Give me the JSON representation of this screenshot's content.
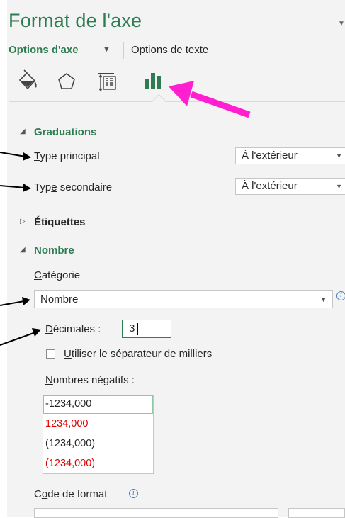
{
  "pane": {
    "title": "Format de l'axe",
    "tabs": {
      "axis_options": "Options d'axe",
      "text_options": "Options de texte"
    },
    "icons": [
      "fill-line-icon",
      "effects-icon",
      "size-properties-icon",
      "axis-options-icon"
    ]
  },
  "graduations": {
    "header": "Graduations",
    "major_type": {
      "label_first": "T",
      "label_rest": "ype principal",
      "value": "À l'extérieur"
    },
    "minor_type": {
      "label_a": "Typ",
      "label_b": "e",
      "label_c": " secondaire",
      "value": "À l'extérieur"
    }
  },
  "etiquettes": {
    "header": "Étiquettes"
  },
  "nombre": {
    "header": "Nombre",
    "category": {
      "label_first": "C",
      "label_rest": "atégorie",
      "value": "Nombre"
    },
    "decimals": {
      "label_first": "D",
      "label_rest": "écimales :",
      "value": "3"
    },
    "thousands": {
      "label_first": "U",
      "label_rest": "tiliser le séparateur de milliers"
    },
    "negatives": {
      "label_first": "N",
      "label_rest": "ombres négatifs :",
      "items": [
        "-1234,000",
        "1234,000",
        "(1234,000)",
        "(1234,000)"
      ]
    },
    "format_code": {
      "label_a": "C",
      "label_b": "o",
      "label_c": "de de format"
    }
  },
  "colors": {
    "accent": "#2e7d52",
    "negative_red": "#e00000",
    "annotation_arrow": "#ff1fd0",
    "black_arrow": "#000000"
  }
}
